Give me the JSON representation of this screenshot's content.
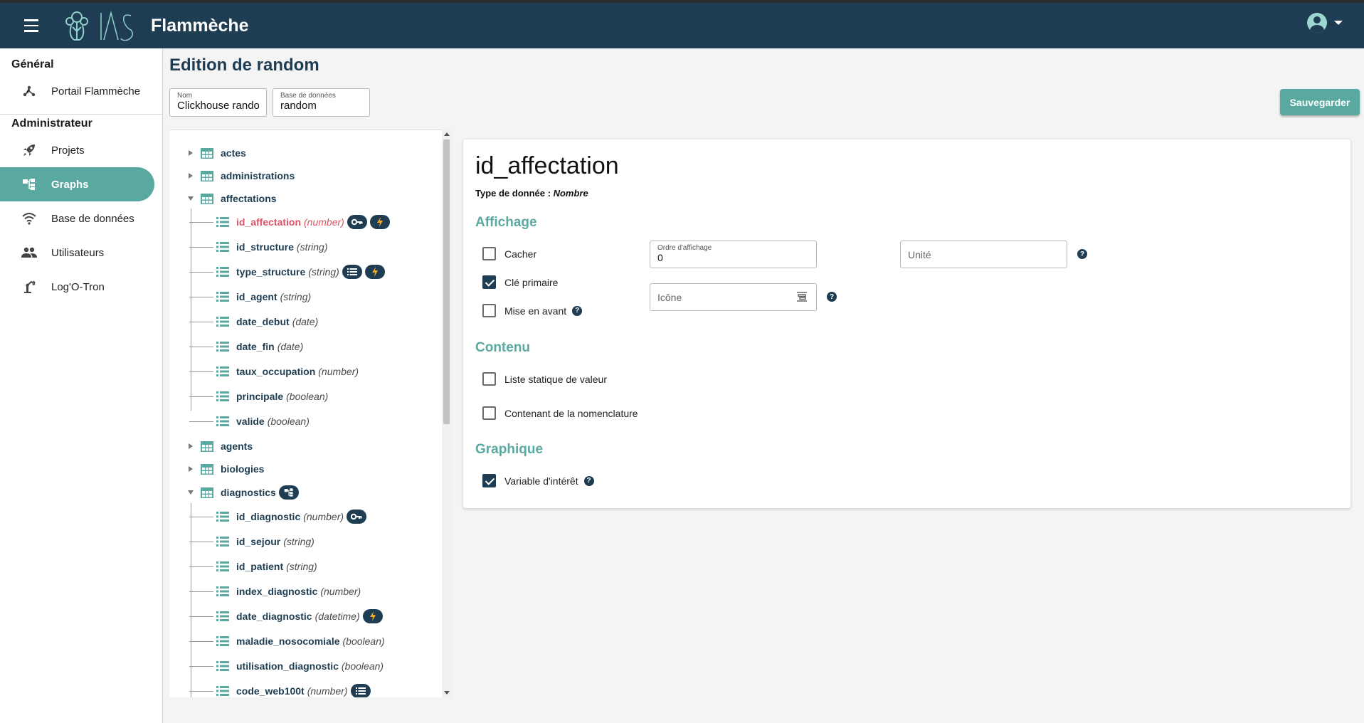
{
  "app": {
    "title": "Flammèche",
    "logo_text": "IAS"
  },
  "header": {
    "menu_icon": "hamburger-icon",
    "user_icon": "account-circle-icon",
    "dropdown_icon": "caret-down-icon"
  },
  "sidebar": {
    "sections": [
      {
        "title": "Général"
      },
      {
        "title": "Administrateur"
      }
    ],
    "items": [
      {
        "label": "Portail Flammèche",
        "icon": "hub-icon"
      },
      {
        "label": "Projets",
        "icon": "rocket-icon"
      },
      {
        "label": "Graphs",
        "icon": "graph-tree-icon",
        "active": true
      },
      {
        "label": "Base de données",
        "icon": "wifi-icon"
      },
      {
        "label": "Utilisateurs",
        "icon": "people-icon"
      },
      {
        "label": "Log'O-Tron",
        "icon": "robot-arm-icon"
      }
    ]
  },
  "page": {
    "title": "Edition de random",
    "name_field": {
      "label": "Nom",
      "value": "Clickhouse random"
    },
    "db_field": {
      "label": "Base de données",
      "value": "random"
    },
    "save_label": "Sauvegarder"
  },
  "tree": {
    "tables": [
      {
        "name": "actes",
        "expanded": false
      },
      {
        "name": "administrations",
        "expanded": false
      },
      {
        "name": "affectations",
        "expanded": true
      },
      {
        "name": "agents",
        "expanded": false
      },
      {
        "name": "biologies",
        "expanded": false
      },
      {
        "name": "diagnostics",
        "expanded": true,
        "badge": "graph-tree-icon"
      }
    ],
    "affectations_fields": [
      {
        "name": "id_affectation",
        "type": "(number)",
        "selected": true,
        "badges": [
          "key-icon",
          "bolt-icon"
        ]
      },
      {
        "name": "id_structure",
        "type": "(string)"
      },
      {
        "name": "type_structure",
        "type": "(string)",
        "badges": [
          "list-icon",
          "bolt-icon"
        ]
      },
      {
        "name": "id_agent",
        "type": "(string)"
      },
      {
        "name": "date_debut",
        "type": "(date)"
      },
      {
        "name": "date_fin",
        "type": "(date)"
      },
      {
        "name": "taux_occupation",
        "type": "(number)"
      },
      {
        "name": "principale",
        "type": "(boolean)"
      },
      {
        "name": "valide",
        "type": "(boolean)"
      }
    ],
    "diagnostics_fields": [
      {
        "name": "id_diagnostic",
        "type": "(number)",
        "badges": [
          "key-icon"
        ]
      },
      {
        "name": "id_sejour",
        "type": "(string)"
      },
      {
        "name": "id_patient",
        "type": "(string)"
      },
      {
        "name": "index_diagnostic",
        "type": "(number)"
      },
      {
        "name": "date_diagnostic",
        "type": "(datetime)",
        "badges": [
          "bolt-icon"
        ]
      },
      {
        "name": "maladie_nosocomiale",
        "type": "(boolean)"
      },
      {
        "name": "utilisation_diagnostic",
        "type": "(boolean)"
      },
      {
        "name": "code_web100t",
        "type": "(number)",
        "badges": [
          "list-icon"
        ]
      }
    ]
  },
  "detail": {
    "title": "id_affectation",
    "type_label": "Type de donnée : ",
    "type_value": "Nombre",
    "sections": {
      "affichage": "Affichage",
      "contenu": "Contenu",
      "graphique": "Graphique"
    },
    "checkboxes": {
      "cacher": {
        "label": "Cacher",
        "checked": false
      },
      "cle_primaire": {
        "label": "Clé primaire",
        "checked": true
      },
      "mise_en_avant": {
        "label": "Mise en avant",
        "checked": false
      },
      "liste_statique": {
        "label": "Liste statique de valeur",
        "checked": false
      },
      "nomenclature": {
        "label": "Contenant de la nomenclature",
        "checked": false
      },
      "variable_interet": {
        "label": "Variable d'intérêt",
        "checked": true
      }
    },
    "ordre_affichage": {
      "label": "Ordre d'affichage",
      "value": "0"
    },
    "icone": {
      "placeholder": "Icône"
    },
    "unite": {
      "placeholder": "Unité"
    },
    "help_glyph": "?"
  },
  "colors": {
    "header": "#1f3d52",
    "accent": "#5aa9a0",
    "selected_field": "#e05366"
  }
}
